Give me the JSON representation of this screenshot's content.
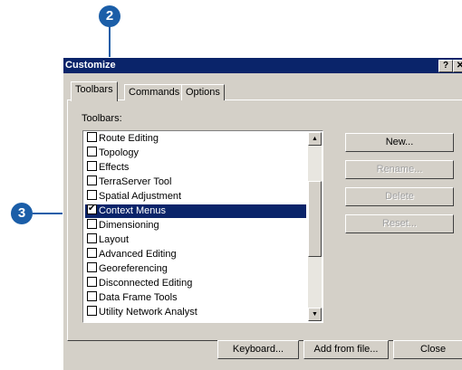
{
  "callouts": {
    "step_2": "2",
    "step_3": "3"
  },
  "window": {
    "title": "Customize",
    "help_glyph": "?",
    "close_glyph": "✕"
  },
  "tabs": [
    {
      "label": "Toolbars",
      "active": true
    },
    {
      "label": "Commands",
      "active": false
    },
    {
      "label": "Options",
      "active": false
    }
  ],
  "toolbars_label": "Toolbars:",
  "toolbars": [
    {
      "label": "Route Editing",
      "checked": false,
      "selected": false
    },
    {
      "label": "Topology",
      "checked": false,
      "selected": false
    },
    {
      "label": "Effects",
      "checked": false,
      "selected": false
    },
    {
      "label": "TerraServer Tool",
      "checked": false,
      "selected": false
    },
    {
      "label": "Spatial Adjustment",
      "checked": false,
      "selected": false
    },
    {
      "label": "Context Menus",
      "checked": true,
      "selected": true
    },
    {
      "label": "Dimensioning",
      "checked": false,
      "selected": false
    },
    {
      "label": "Layout",
      "checked": false,
      "selected": false
    },
    {
      "label": "Advanced Editing",
      "checked": false,
      "selected": false
    },
    {
      "label": "Georeferencing",
      "checked": false,
      "selected": false
    },
    {
      "label": "Disconnected Editing",
      "checked": false,
      "selected": false
    },
    {
      "label": "Data Frame Tools",
      "checked": false,
      "selected": false
    },
    {
      "label": "Utility Network Analyst",
      "checked": false,
      "selected": false
    }
  ],
  "side_buttons": {
    "new": "New...",
    "rename": "Rename...",
    "delete": "Delete",
    "reset": "Reset..."
  },
  "bottom_buttons": {
    "keyboard": "Keyboard...",
    "add_from_file": "Add from file...",
    "close": "Close"
  },
  "colors": {
    "title_bar": "#0a246a",
    "callout": "#1b5ea8",
    "selection": "#0a246a"
  }
}
